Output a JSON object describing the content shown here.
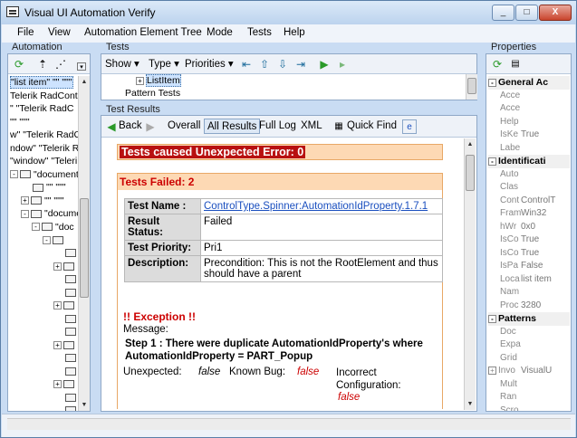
{
  "window": {
    "title": "Visual UI Automation Verify",
    "min_label": "_",
    "max_label": "□",
    "close_label": "X"
  },
  "menu": [
    "File",
    "View",
    "Automation Element Tree",
    "Mode",
    "Tests",
    "Help"
  ],
  "automation": {
    "title": "Automation",
    "tree": [
      {
        "text": "\"list item\" \"\" \"\"\"",
        "indent": 0,
        "selected": true
      },
      {
        "text": "Telerik RadContro",
        "indent": 0
      },
      {
        "text": "\" \"Telerik RadC",
        "indent": 0
      },
      {
        "text": "\"\" \"\"\"",
        "indent": 0
      },
      {
        "text": "w\" \"Telerik RadCo",
        "indent": 0
      },
      {
        "text": "ndow\" \"Telerik Ra",
        "indent": 0
      },
      {
        "text": "\"window\" \"Teleri",
        "indent": 0
      },
      {
        "text": "\"document\"",
        "indent": 0,
        "node": true,
        "expander": "-"
      },
      {
        "text": "\"\" \"\"\"",
        "indent": 1,
        "node": true
      },
      {
        "text": "\"\" \"\"\"",
        "indent": 1,
        "node": true,
        "expander": "+"
      },
      {
        "text": "\"docume",
        "indent": 1,
        "node": true,
        "expander": "-"
      },
      {
        "text": "\"doc",
        "indent": 2,
        "node": true,
        "expander": "-"
      },
      {
        "text": "",
        "indent": 3,
        "node": true,
        "expander": "-"
      },
      {
        "text": "",
        "indent": 4,
        "node": true
      },
      {
        "text": "",
        "indent": 4,
        "node": true,
        "expander": "+"
      },
      {
        "text": "",
        "indent": 4,
        "node": true
      },
      {
        "text": "",
        "indent": 4,
        "node": true
      },
      {
        "text": "",
        "indent": 4,
        "node": true,
        "expander": "+"
      },
      {
        "text": "",
        "indent": 4,
        "node": true
      },
      {
        "text": "",
        "indent": 4,
        "node": true
      },
      {
        "text": "",
        "indent": 4,
        "node": true,
        "expander": "+"
      },
      {
        "text": "",
        "indent": 4,
        "node": true
      },
      {
        "text": "",
        "indent": 4,
        "node": true
      },
      {
        "text": "",
        "indent": 4,
        "node": true,
        "expander": "+"
      },
      {
        "text": "",
        "indent": 4,
        "node": true
      },
      {
        "text": "",
        "indent": 4,
        "node": true
      }
    ]
  },
  "tests": {
    "title": "Tests",
    "show": "Show",
    "type": "Type",
    "priorities": "Priorities",
    "tree": [
      "ListItem",
      "Pattern Tests"
    ]
  },
  "results": {
    "title": "Test Results",
    "back": "Back",
    "overall": "Overall",
    "all_results": "All Results",
    "full_log": "Full Log",
    "xml": "XML",
    "quick_find": "Quick Find",
    "error_header": "Tests caused Unexpected Error: 0",
    "failed_header": "Tests Failed: 2",
    "rows": [
      {
        "key": "Test Name :",
        "value": "ControlType.Spinner:AutomationIdProperty.1.7.1",
        "link": true
      },
      {
        "key": "Result Status:",
        "value": "Failed"
      },
      {
        "key": "Test Priority:",
        "value": "Pri1"
      },
      {
        "key": "Description:",
        "value": "Precondition: This is not the RootElement and thus should have a parent"
      }
    ],
    "exception_title": "!! Exception !!",
    "message_label": "Message:",
    "message": "Step 1 : There were duplicate AutomationIdProperty's where AutomationIdProperty = PART_Popup",
    "unexpected_label": "Unexpected:",
    "unexpected_value": "false",
    "known_bug_label": "Known Bug:",
    "known_bug_value": "false",
    "incorrect_label": "Incorrect Configuration:",
    "incorrect_value": "false"
  },
  "properties": {
    "title": "Properties",
    "items": [
      {
        "cat": true,
        "name": "General Ac",
        "expander": "-"
      },
      {
        "name": "Acce"
      },
      {
        "name": "Acce"
      },
      {
        "name": "Help"
      },
      {
        "name": "IsKe",
        "value": "True"
      },
      {
        "name": "Labe"
      },
      {
        "cat": true,
        "name": "Identificati",
        "expander": "-"
      },
      {
        "name": "Auto"
      },
      {
        "name": "Clas"
      },
      {
        "name": "Cont",
        "value": "ControlT"
      },
      {
        "name": "Fram",
        "value": "Win32"
      },
      {
        "name": "hWr",
        "value": "0x0"
      },
      {
        "name": "IsCo",
        "value": "True"
      },
      {
        "name": "IsCo",
        "value": "True"
      },
      {
        "name": "IsPa",
        "value": "False"
      },
      {
        "name": "Loca",
        "value": "list item"
      },
      {
        "name": "Nam"
      },
      {
        "name": "Proc",
        "value": "3280"
      },
      {
        "cat": true,
        "name": "Patterns",
        "expander": "-"
      },
      {
        "name": "Doc"
      },
      {
        "name": "Expa"
      },
      {
        "name": "Grid"
      },
      {
        "name": "Invo",
        "value": "VisualU",
        "expander": "+"
      },
      {
        "name": "Mult"
      },
      {
        "name": "Ran"
      },
      {
        "name": "Scro"
      }
    ]
  }
}
